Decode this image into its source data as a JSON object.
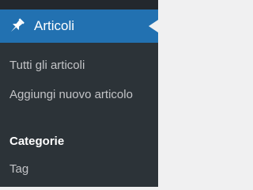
{
  "menu": {
    "label": "Articoli",
    "icon": "pushpin-icon",
    "accent_color": "#2271b1",
    "sidebar_color": "#2c3338"
  },
  "submenu": {
    "items": [
      {
        "label": "Tutti gli articoli",
        "current": false
      },
      {
        "label": "Aggiungi nuovo articolo",
        "current": false
      },
      {
        "label": "Categorie",
        "current": true
      },
      {
        "label": "Tag",
        "current": false
      }
    ]
  }
}
